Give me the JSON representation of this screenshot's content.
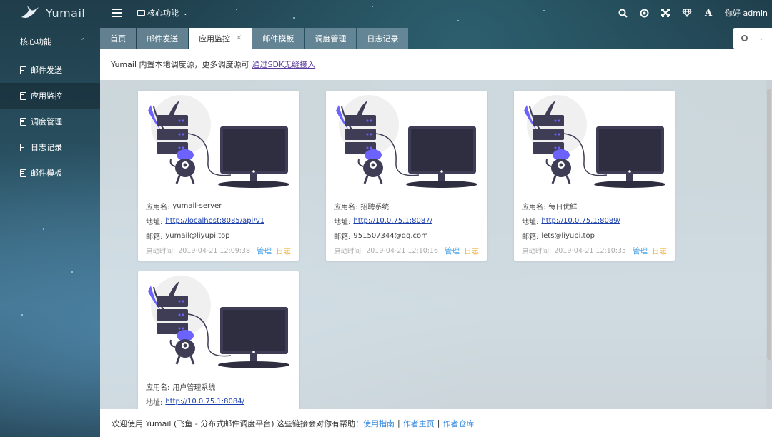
{
  "app": {
    "name": "Yumail"
  },
  "header": {
    "module_label": "核心功能",
    "greeting": "你好 admin",
    "icons": [
      "search-icon",
      "target-icon",
      "fullscreen-icon",
      "diamond-icon",
      "font-icon"
    ]
  },
  "sidebar": {
    "group_label": "核心功能",
    "items": [
      {
        "label": "邮件发送"
      },
      {
        "label": "应用监控"
      },
      {
        "label": "调度管理"
      },
      {
        "label": "日志记录"
      },
      {
        "label": "邮件模板"
      }
    ]
  },
  "tabs": [
    {
      "label": "首页"
    },
    {
      "label": "邮件发送"
    },
    {
      "label": "应用监控"
    },
    {
      "label": "邮件模板"
    },
    {
      "label": "调度管理"
    },
    {
      "label": "日志记录"
    }
  ],
  "notice": {
    "text": "Yumail 内置本地调度源，更多调度源可",
    "link": "通过SDK无缝接入"
  },
  "labels": {
    "name": "应用名:",
    "address": "地址:",
    "email": "邮箱:",
    "start_time": "启动时间:",
    "manage": "管理",
    "log": "日志"
  },
  "apps": [
    {
      "name": "yumail-server",
      "address": "http://localhost:8085/api/v1",
      "email": "yumail@liyupi.top",
      "start_time": "2019-04-21 12:09:38"
    },
    {
      "name": "招聘系统",
      "address": "http://10.0.75.1:8087/",
      "email": "951507344@qq.com",
      "start_time": "2019-04-21 12:10:16"
    },
    {
      "name": "每日优鲜",
      "address": "http://10.0.75.1:8089/",
      "email": "lets@liyupi.top",
      "start_time": "2019-04-21 12:10:35"
    },
    {
      "name": "用户管理系统",
      "address": "http://10.0.75.1:8084/"
    }
  ],
  "footer": {
    "text": "欢迎使用 Yumail (飞鱼 - 分布式邮件调度平台)  这些链接会对你有帮助：",
    "links": [
      "使用指南",
      "作者主页",
      "作者仓库"
    ],
    "separator": "|"
  },
  "colors": {
    "accent": "#4aa3e8",
    "log": "#e8a317",
    "link": "#1a3faa",
    "illustration": "#3f3d56",
    "illustration_accent": "#6c63ff"
  }
}
